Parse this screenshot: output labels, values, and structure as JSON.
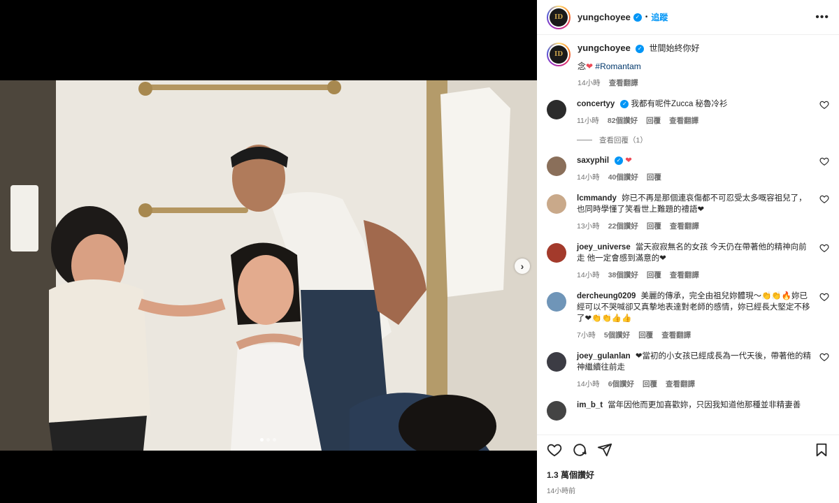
{
  "post": {
    "username": "yungchoyee",
    "follow_label": "追蹤",
    "more_label": "•••",
    "avatar_text": "ID"
  },
  "caption": {
    "username": "yungchoyee",
    "text": "世間始終你好",
    "line2_prefix": "念",
    "heart": "❤",
    "hashtag": "#Romantam",
    "time": "14小時",
    "translate": "查看翻譯"
  },
  "comments": [
    {
      "username": "concertyy",
      "verified": true,
      "text": "我都有呢件Zucca 秘魯冷衫",
      "time": "11小時",
      "likes": "82個讚好",
      "reply": "回覆",
      "translate": "查看翻譯",
      "view_replies": "查看回覆（1）",
      "avatar_color": "#2b2b2b"
    },
    {
      "username": "saxyphil",
      "verified": true,
      "text": "❤",
      "time": "14小時",
      "likes": "40個讚好",
      "reply": "回覆",
      "translate": "",
      "avatar_color": "#8a6f5a"
    },
    {
      "username": "lcmmandy",
      "verified": false,
      "text": "妳已不再是那個連哀傷都不可忍受太多嘅容祖兒了，也同時學懂了笑看世上難題的禮語❤",
      "time": "13小時",
      "likes": "22個讚好",
      "reply": "回覆",
      "translate": "查看翻譯",
      "avatar_color": "#c9a98a"
    },
    {
      "username": "joey_universe",
      "verified": false,
      "text": "當天寂寂無名的女孩 今天仍在帶著他的精神向前走 他一定會感到滿意的❤",
      "time": "14小時",
      "likes": "38個讚好",
      "reply": "回覆",
      "translate": "查看翻譯",
      "avatar_color": "#a33a2b"
    },
    {
      "username": "dercheung0209",
      "verified": false,
      "text": "美麗的傳承，完全由祖兒妳體現～👏👏🔥妳已經可以不哭喊卻又真摯地表達對老師的感情，妳已經長大堅定不移了❤👏👏👍👍",
      "time": "7小時",
      "likes": "5個讚好",
      "reply": "回覆",
      "translate": "查看翻譯",
      "avatar_color": "#6f95b8"
    },
    {
      "username": "joey_gulanlan",
      "verified": false,
      "text": "❤當初的小女孩已經成長為一代天後，帶著他的精神繼續往前走",
      "time": "14小時",
      "likes": "6個讚好",
      "reply": "回覆",
      "translate": "查看翻譯",
      "avatar_color": "#3c3c44"
    },
    {
      "username": "im_b_t",
      "verified": false,
      "text": "當年因他而更加喜歡妳，只因我知道他那種並非精妻善",
      "time": "",
      "likes": "",
      "reply": "",
      "translate": "",
      "avatar_color": "#444"
    }
  ],
  "footer": {
    "likes": "1.3 萬個讚好",
    "time": "14小時前"
  },
  "media": {
    "next_arrow": "›",
    "slide_index": 1,
    "slide_count": 3
  }
}
